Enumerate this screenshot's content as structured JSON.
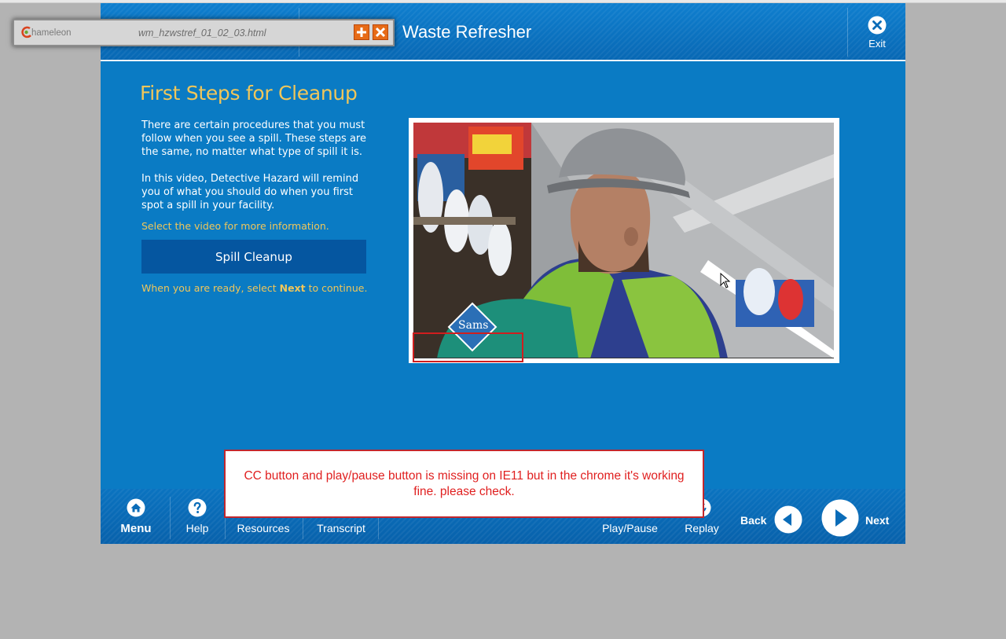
{
  "window": {
    "course_title": "Waste Refresher",
    "exit_label": "Exit"
  },
  "content": {
    "page_title": "First Steps for Cleanup",
    "paragraph_1": "There are certain procedures that you must follow when you see a spill.  These steps are the same, no matter what type of spill it is.",
    "paragraph_2": "In this video, Detective Hazard will remind you of what you should do when you first spot a spill in your facility.",
    "select_hint": "Select the video for more information.",
    "spill_button": "Spill Cleanup",
    "continue_hint_before": "When you are ready, select ",
    "continue_hint_bold": "Next",
    "continue_hint_after": " to continue.",
    "video_logo_text": "Sams"
  },
  "footer": {
    "menu": "Menu",
    "help": "Help",
    "resources": "Resources",
    "transcript": "Transcript",
    "play_pause": "Play/Pause",
    "replay": "Replay",
    "back": "Back",
    "next": "Next"
  },
  "popup": {
    "logo_text": "hameleon",
    "filename": "wm_hzwstref_01_02_03.html"
  },
  "annotation": {
    "note": "CC button and play/pause button is missing on IE11 but in the chrome it's working fine. please check."
  },
  "colors": {
    "course_bg": "#0a7bc4",
    "title_gold": "#f0c65a",
    "button_dark_blue": "#0556a0",
    "annotation_red": "#e02020"
  },
  "icons": [
    "close-icon",
    "home-icon",
    "help-icon",
    "replay-icon",
    "back-arrow-icon",
    "next-arrow-icon",
    "plus-icon",
    "close-x-icon",
    "mouse-cursor-icon"
  ]
}
